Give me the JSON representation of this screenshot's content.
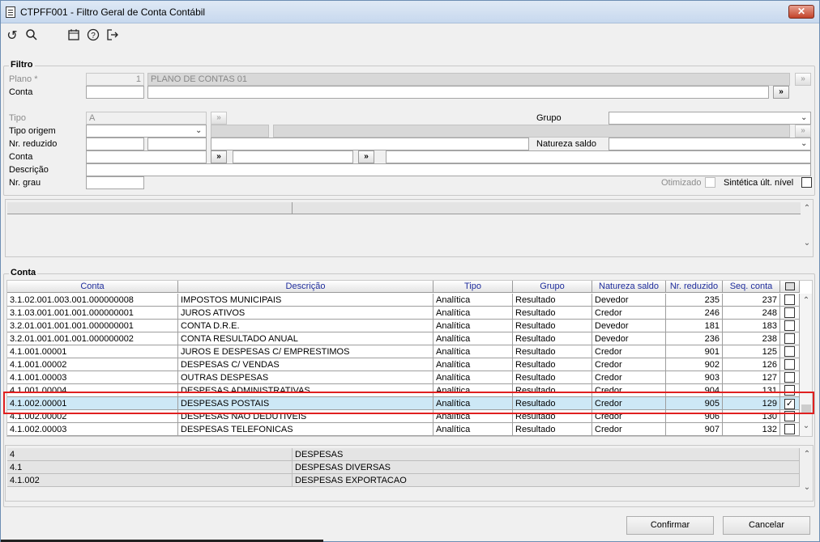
{
  "window": {
    "title": "CTPFF001 - Filtro Geral de Conta Contábil",
    "close": "✕"
  },
  "toolbar": {
    "icons": [
      "undo-icon",
      "search-icon",
      "calendar-icon",
      "help-icon",
      "exit-icon"
    ]
  },
  "filtro": {
    "title": "Filtro",
    "plano_label": "Plano *",
    "plano_value": "1",
    "plano_desc": "PLANO DE CONTAS 01",
    "conta_label": "Conta",
    "tipo_label": "Tipo",
    "tipo_value": "A",
    "grupo_label": "Grupo",
    "tipo_origem_label": "Tipo origem",
    "nr_reduzido_label": "Nr. reduzido",
    "natureza_saldo_label": "Natureza saldo",
    "conta2_label": "Conta",
    "descricao_label": "Descrição",
    "nr_grau_label": "Nr. grau",
    "otimizado_label": "Otimizado",
    "sintetica_label": "Sintética últ. nível",
    "browse": "»"
  },
  "conta": {
    "title": "Conta",
    "headers": [
      "Conta",
      "Descrição",
      "Tipo",
      "Grupo",
      "Natureza saldo",
      "Nr. reduzido",
      "Seq. conta"
    ],
    "rows": [
      [
        "3.1.02.001.003.001.000000008",
        "IMPOSTOS MUNICIPAIS",
        "Analítica",
        "Resultado",
        "Devedor",
        "235",
        "237"
      ],
      [
        "3.1.03.001.001.001.000000001",
        "JUROS ATIVOS",
        "Analítica",
        "Resultado",
        "Credor",
        "246",
        "248"
      ],
      [
        "3.2.01.001.001.001.000000001",
        "CONTA D.R.E.",
        "Analítica",
        "Resultado",
        "Devedor",
        "181",
        "183"
      ],
      [
        "3.2.01.001.001.001.000000002",
        "CONTA RESULTADO ANUAL",
        "Analítica",
        "Resultado",
        "Devedor",
        "236",
        "238"
      ],
      [
        "4.1.001.00001",
        "JUROS E DESPESAS C/ EMPRESTIMOS",
        "Analítica",
        "Resultado",
        "Credor",
        "901",
        "125"
      ],
      [
        "4.1.001.00002",
        "DESPESAS C/ VENDAS",
        "Analítica",
        "Resultado",
        "Credor",
        "902",
        "126"
      ],
      [
        "4.1.001.00003",
        "OUTRAS DESPESAS",
        "Analítica",
        "Resultado",
        "Credor",
        "903",
        "127"
      ],
      [
        "4.1.001.00004",
        "DESPESAS ADMINISTRATIVAS",
        "Analítica",
        "Resultado",
        "Credor",
        "904",
        "131"
      ],
      [
        "4.1.002.00001",
        "DESPESAS POSTAIS",
        "Analítica",
        "Resultado",
        "Credor",
        "905",
        "129"
      ],
      [
        "4.1.002.00002",
        "DESPESAS NAO DEDUTIVEIS",
        "Analítica",
        "Resultado",
        "Credor",
        "906",
        "130"
      ],
      [
        "4.1.002.00003",
        "DESPESAS TELEFONICAS",
        "Analítica",
        "Resultado",
        "Credor",
        "907",
        "132"
      ]
    ],
    "selected_index": 8
  },
  "summary": {
    "rows": [
      [
        "4",
        "DESPESAS"
      ],
      [
        "4.1",
        "DESPESAS DIVERSAS"
      ],
      [
        "4.1.002",
        "DESPESAS EXPORTACAO"
      ]
    ]
  },
  "buttons": {
    "confirmar": "Confirmar",
    "cancelar": "Cancelar"
  }
}
